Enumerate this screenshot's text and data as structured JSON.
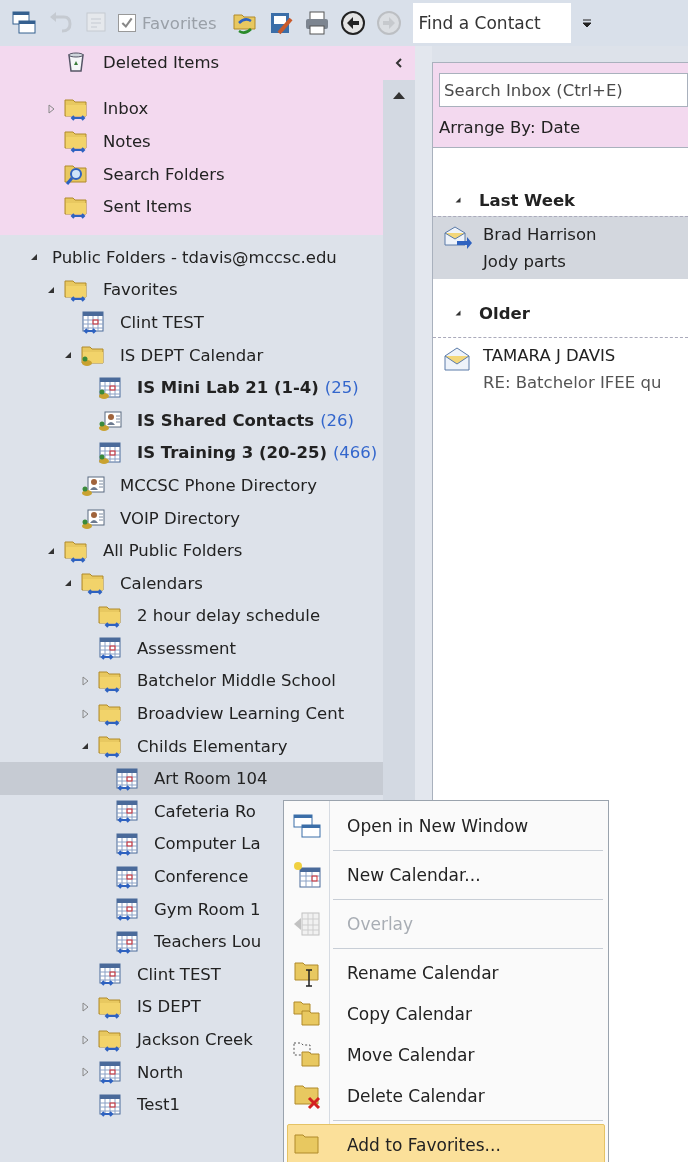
{
  "toolbar": {
    "left_buttons": [
      {
        "disabled": false
      },
      {
        "disabled": true
      },
      {
        "disabled": true
      }
    ],
    "favorites_checkbox": {
      "label": "Favorites",
      "checked": true,
      "disabled": true
    },
    "right_buttons": [
      {
        "disabled": false
      },
      {
        "disabled": false
      },
      {
        "disabled": false
      },
      {
        "disabled": false
      },
      {
        "disabled": true
      }
    ],
    "find_contact": {
      "value": "Find a Contact"
    }
  },
  "folder_pane": {
    "mailbox_folders": [
      {
        "label": "Deleted Items",
        "kind": "trash",
        "selected": false
      },
      {
        "label": "Inbox",
        "kind": "folder",
        "expanded": false,
        "selected": false
      },
      {
        "label": "Notes",
        "kind": "folder",
        "selected": false
      },
      {
        "label": "Search Folders",
        "kind": "search",
        "selected": false
      },
      {
        "label": "Sent Items",
        "kind": "folder",
        "selected": false
      }
    ],
    "public_folders": {
      "label": "Public Folders - tdavis@mccsc.edu",
      "expanded": true,
      "selected": false,
      "children": [
        {
          "label": "Favorites",
          "kind": "folder",
          "expanded": true,
          "selected": false,
          "children": [
            {
              "label": "Clint TEST",
              "kind": "calendar",
              "selected": false
            },
            {
              "label": "IS DEPT Calendar",
              "kind": "shared",
              "expanded": true,
              "selected": false,
              "children": [
                {
                  "label": "IS Mini Lab 21 (1-4)",
                  "count": "(25)",
                  "bold": true,
                  "kind": "shared-calendar",
                  "selected": false
                },
                {
                  "label": "IS Shared Contacts",
                  "count": "(26)",
                  "bold": true,
                  "kind": "contacts",
                  "selected": false
                },
                {
                  "label": "IS Training 3 (20-25)",
                  "count": "(466)",
                  "bold": true,
                  "kind": "shared-calendar",
                  "selected": false
                }
              ]
            },
            {
              "label": "MCCSC Phone Directory",
              "kind": "contacts",
              "selected": false
            },
            {
              "label": "VOIP Directory",
              "kind": "contacts",
              "selected": false
            }
          ]
        },
        {
          "label": "All Public Folders",
          "kind": "folder",
          "expanded": true,
          "selected": false,
          "children": [
            {
              "label": "Calendars",
              "kind": "folder",
              "expanded": true,
              "selected": false,
              "children": [
                {
                  "label": "2 hour delay schedule",
                  "kind": "folder",
                  "selected": false
                },
                {
                  "label": "Assessment",
                  "kind": "calendar",
                  "selected": false
                },
                {
                  "label": "Batchelor Middle School",
                  "kind": "folder",
                  "expanded": false,
                  "selected": false
                },
                {
                  "label": "Broadview Learning Cent",
                  "kind": "folder",
                  "expanded": false,
                  "selected": false
                },
                {
                  "label": "Childs Elementary",
                  "kind": "folder",
                  "expanded": true,
                  "selected": false,
                  "children": [
                    {
                      "label": "Art Room 104",
                      "kind": "calendar",
                      "selected": true
                    },
                    {
                      "label": "Cafeteria Ro",
                      "kind": "calendar",
                      "selected": false
                    },
                    {
                      "label": "Computer La",
                      "kind": "calendar",
                      "selected": false
                    },
                    {
                      "label": "Conference",
                      "kind": "calendar",
                      "selected": false
                    },
                    {
                      "label": "Gym Room 1",
                      "kind": "calendar",
                      "selected": false
                    },
                    {
                      "label": "Teachers Lou",
                      "kind": "calendar",
                      "selected": false
                    }
                  ]
                },
                {
                  "label": "Clint TEST",
                  "kind": "calendar",
                  "selected": false
                },
                {
                  "label": "IS DEPT",
                  "kind": "folder",
                  "expanded": false,
                  "selected": false
                },
                {
                  "label": "Jackson Creek",
                  "kind": "folder",
                  "expanded": false,
                  "selected": false
                },
                {
                  "label": "North",
                  "kind": "calendar",
                  "expanded": false,
                  "selected": false
                },
                {
                  "label": "Test1",
                  "kind": "calendar",
                  "selected": false
                }
              ]
            }
          ]
        }
      ]
    }
  },
  "message_pane": {
    "search": {
      "placeholder": "Search Inbox (Ctrl+E)"
    },
    "arrange_by": "Arrange By: Date",
    "groups": [
      {
        "label": "Last Week",
        "expanded": true,
        "messages": [
          {
            "sender": "Brad Harrison",
            "subject": "Jody parts",
            "kind": "forwarded",
            "selected": true
          }
        ]
      },
      {
        "label": "Older",
        "expanded": true,
        "messages": [
          {
            "sender": "TAMARA J DAVIS",
            "subject": "RE: Batchelor IFEE qu",
            "kind": "read",
            "selected": false
          }
        ]
      }
    ]
  },
  "context_menu": {
    "items": [
      {
        "label": "Open in New Window",
        "kind": "windows",
        "disabled": false,
        "selected": false,
        "separator_after": true
      },
      {
        "label": "New Calendar...",
        "kind": "new-calendar",
        "disabled": false,
        "selected": false,
        "separator_after": true
      },
      {
        "label": "Overlay",
        "kind": "overlay",
        "disabled": true,
        "selected": false,
        "separator_after": true
      },
      {
        "label": "Rename Calendar",
        "kind": "rename",
        "disabled": false,
        "selected": false,
        "separator_after": false
      },
      {
        "label": "Copy Calendar",
        "kind": "copy",
        "disabled": false,
        "selected": false,
        "separator_after": false
      },
      {
        "label": "Move Calendar",
        "kind": "move",
        "disabled": false,
        "selected": false,
        "separator_after": false
      },
      {
        "label": "Delete Calendar",
        "kind": "delete",
        "disabled": false,
        "selected": false,
        "separator_after": true
      },
      {
        "label": "Add to Favorites...",
        "kind": "favorite",
        "disabled": false,
        "selected": true,
        "separator_after": false
      }
    ]
  }
}
